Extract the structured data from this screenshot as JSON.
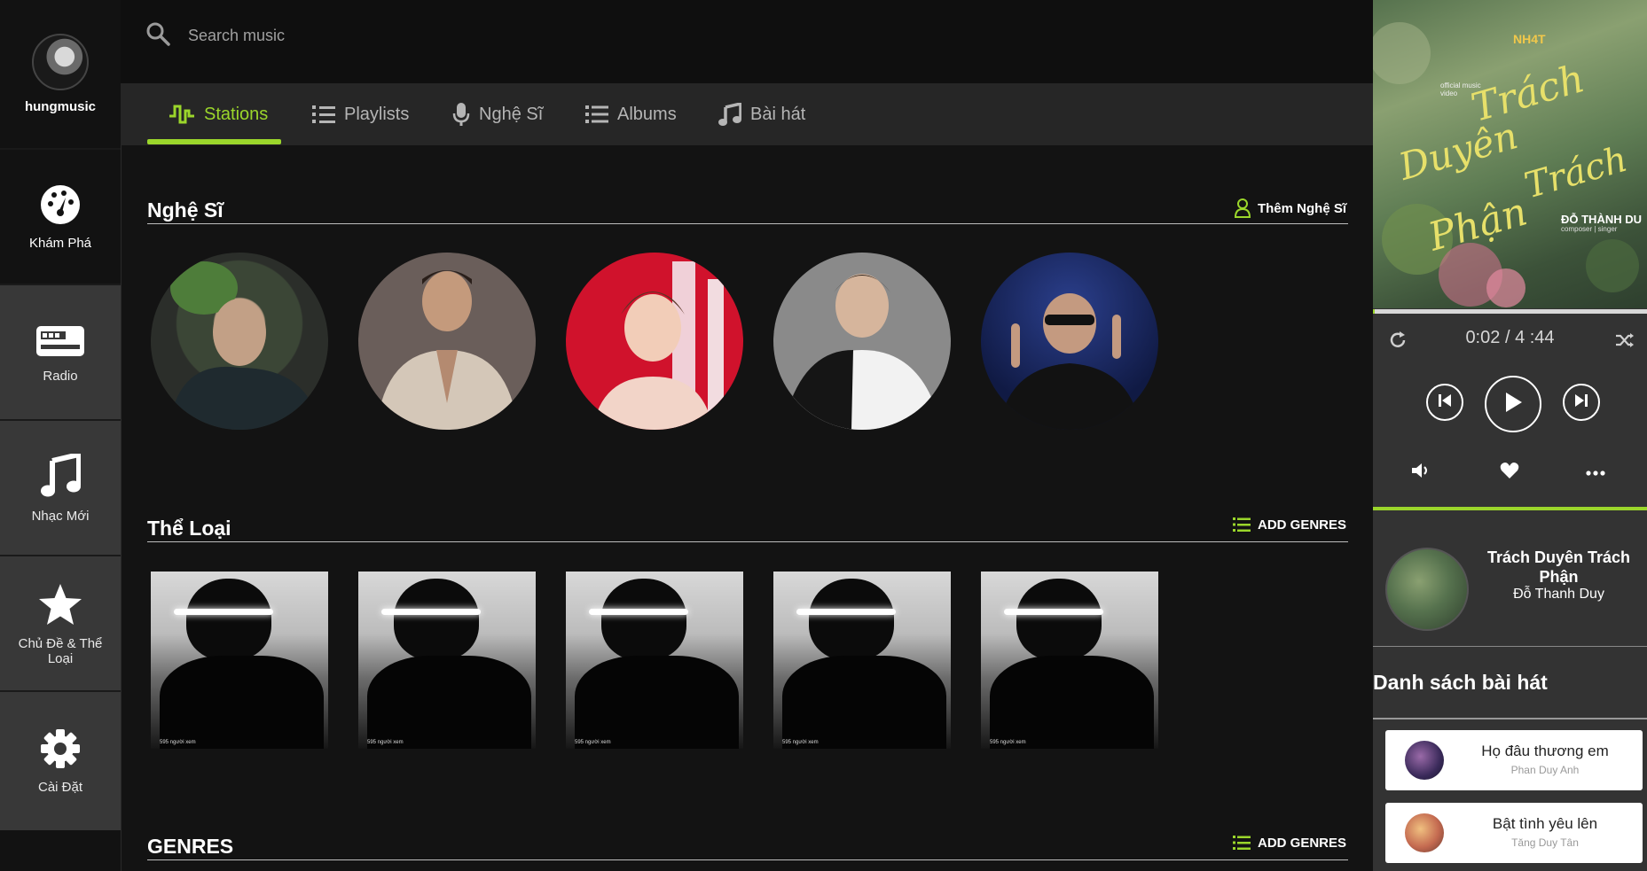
{
  "app": {
    "brand": "hungmusic"
  },
  "sidebar": {
    "items": [
      {
        "label": "Khám Phá",
        "icon": "dashboard-icon"
      },
      {
        "label": "Radio",
        "icon": "radio-icon"
      },
      {
        "label": "Nhạc Mới",
        "icon": "music-note-icon"
      },
      {
        "label": "Chủ Đề & Thể Loại",
        "icon": "star-icon"
      },
      {
        "label": "Cài Đặt",
        "icon": "gear-icon"
      }
    ]
  },
  "search": {
    "placeholder": "Search music"
  },
  "tabs": [
    {
      "label": "Stations",
      "icon": "stations-icon",
      "active": true
    },
    {
      "label": "Playlists",
      "icon": "playlist-icon"
    },
    {
      "label": "Nghệ Sĩ",
      "icon": "microphone-icon"
    },
    {
      "label": "Albums",
      "icon": "list-icon"
    },
    {
      "label": "Bài hát",
      "icon": "music-note-icon"
    }
  ],
  "sections": {
    "artists": {
      "title": "Nghệ Sĩ",
      "action": "Thêm Nghệ Sĩ"
    },
    "genres": {
      "title": "Thể Loại",
      "action": "ADD GENRES",
      "card_views": [
        "595 người xem",
        "595 người xem",
        "595 người xem",
        "595 người xem",
        "595 người xem"
      ]
    },
    "genres2": {
      "title": "GENRES",
      "action": "ADD GENRES"
    }
  },
  "player": {
    "cover": {
      "brand": "NH4T",
      "official": "official music video",
      "title_lines": [
        "Trách",
        "Duyên",
        "Trách",
        "Phận"
      ],
      "artist": "ĐỖ THÀNH DU",
      "role": "composer | singer"
    },
    "current_time": "0:02",
    "separator": "/",
    "total_time": "4 :44",
    "progress": 0.008,
    "now_playing": {
      "title": "Trách Duyên Trách Phận",
      "artist": "Đỗ Thanh Duy"
    }
  },
  "playlist": {
    "heading": "Danh sách bài hát",
    "songs": [
      {
        "title": "Họ đâu thương em",
        "artist": "Phan Duy Anh"
      },
      {
        "title": "Bật tình yêu lên",
        "artist": "Tăng Duy Tân"
      }
    ]
  },
  "colors": {
    "accent": "#9bd62b",
    "background": "#131313",
    "sidebar_item": "#383838",
    "player": "#333333"
  }
}
